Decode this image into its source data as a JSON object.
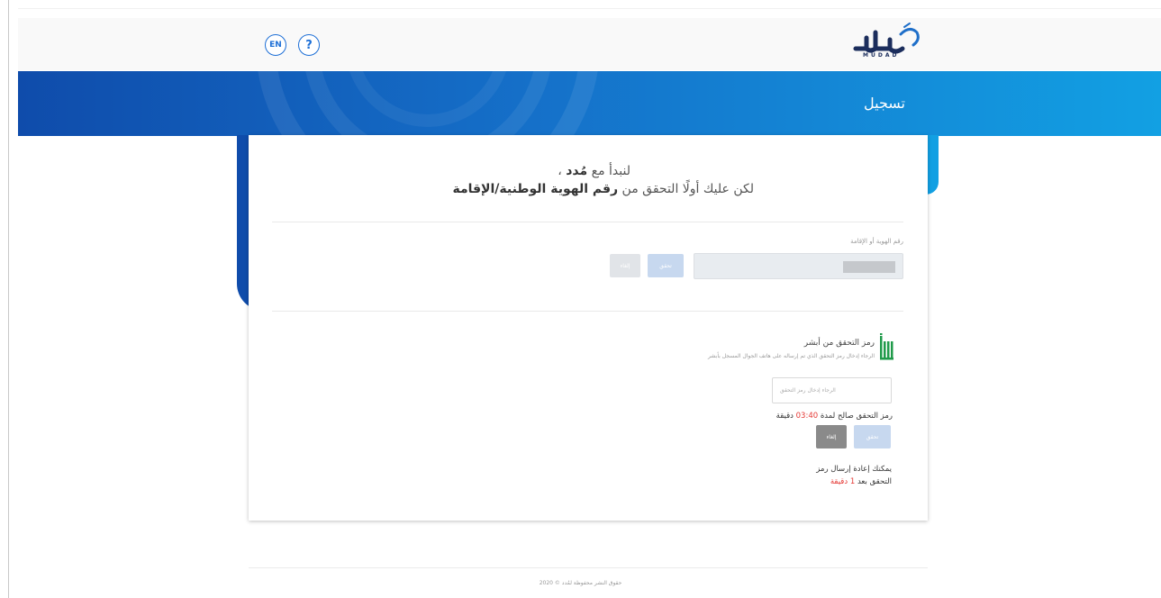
{
  "header": {
    "lang_label": "EN",
    "help_label": "?",
    "logo_text": "MUDAD",
    "logo_icon": "mudad-logo"
  },
  "banner": {
    "title": "تسجيل"
  },
  "intro": {
    "line1_prefix": "لنبدأ مع ",
    "line1_brand": "مُدد",
    "line1_suffix": " ،",
    "line2_prefix": "لكن عليك أولًا التحقق من ",
    "line2_bold": "رقم الهوية الوطنية/الإقامة"
  },
  "id_section": {
    "label": "رقم الهوية أو الإقامة",
    "verify_label": "تحقق",
    "cancel_label": "إلغاء"
  },
  "absher": {
    "icon": "absher-icon",
    "title": "رمز التحقق من أبشر",
    "subtitle": "الرجاء إدخال رمز التحقق الذي تم إرساله على هاتف الجوال المسجل بأبشر",
    "otp_placeholder": "الرجاء إدخال رمز التحقق",
    "valid_prefix": "رمز التحقق صالح لمدة ",
    "valid_time": "03:40",
    "valid_suffix": " دقيقة",
    "verify_label": "تحقق",
    "cancel_label": "إلغاء",
    "resend_line1": "يمكنك إعادة إرسال رمز",
    "resend_line2_prefix": "التحقق بعد ",
    "resend_count": "1",
    "resend_unit": " دقيقة"
  },
  "footer": {
    "text": "حقوق النشر محفوظة لمُدد © 2020"
  },
  "colors": {
    "primary": "#1d6fd6",
    "banner_start": "#0f4cab",
    "banner_end": "#12a0e3",
    "absher_green": "#1f9a4a",
    "timer_red": "#e53935"
  }
}
